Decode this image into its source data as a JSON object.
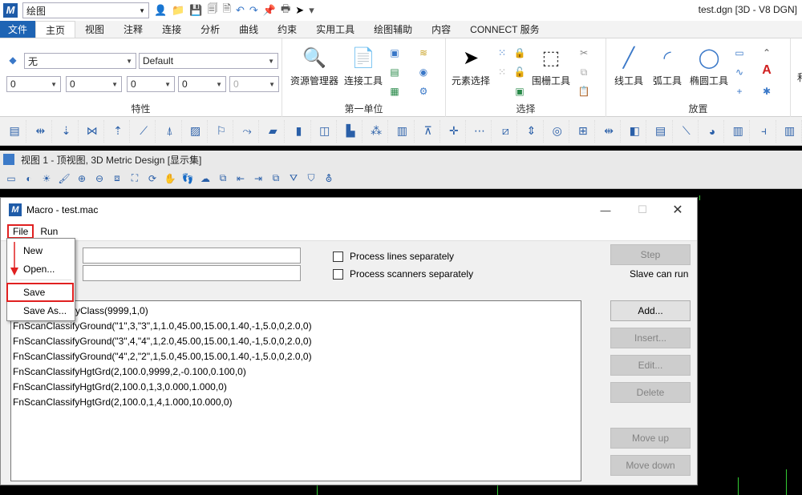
{
  "app": {
    "workspace": "绘图",
    "window_title": "test.dgn [3D - V8 DGN]"
  },
  "ribbon": {
    "tabs": [
      "文件",
      "主页",
      "视图",
      "注释",
      "连接",
      "分析",
      "曲线",
      "约束",
      "实用工具",
      "绘图辅助",
      "内容",
      "CONNECT 服务"
    ],
    "active_tab": "主页",
    "attributes": {
      "level": "无",
      "style": "Default",
      "color": "0",
      "line_style": "0",
      "weight": "0",
      "class": "0",
      "transparency": "0",
      "group_label": "特性"
    },
    "primary": {
      "explorer": "资源管理器",
      "attach": "连接工具",
      "group_label": "第一单位"
    },
    "selection": {
      "element_select": "元素选择",
      "fence": "围栅工具",
      "group_label": "选择"
    },
    "placement": {
      "line": "线工具",
      "arc": "弧工具",
      "ellipse": "椭圆工具",
      "text_icon": "A",
      "group_label": "放置",
      "partial": "和"
    }
  },
  "view": {
    "title": "视图 1 - 顶视图, 3D Metric Design [显示集]"
  },
  "dialog": {
    "title": "Macro - test.mac",
    "menu": {
      "file": "File",
      "run": "Run"
    },
    "dropdown": {
      "new": "New",
      "open": "Open...",
      "save": "Save",
      "save_as": "Save As..."
    },
    "options": {
      "process_lines": "Process lines separately",
      "process_scanners": "Process scanners separately",
      "slave": "Slave can run"
    },
    "buttons": {
      "step": "Step",
      "add": "Add...",
      "insert": "Insert...",
      "edit": "Edit...",
      "delete": "Delete",
      "move_up": "Move up",
      "move_down": "Move down"
    },
    "list": [
      "FnScanSetClass(9999,1,0)",
      "FnScanClassifyGround(\"1\",3,\"3\",1,1.0,45.00,15.00,1.40,-1,5.0,0,2.0,0)",
      "FnScanClassifyGround(\"3\",4,\"4\",1,2.0,45.00,15.00,1.40,-1,5.0,0,2.0,0)",
      "FnScanClassifyGround(\"4\",2,\"2\",1,5.0,45.00,15.00,1.40,-1,5.0,0,2.0,0)",
      "FnScanClassifyHgtGrd(2,100.0,9999,2,-0.100,0.100,0)",
      "FnScanClassifyHgtGrd(2,100.0,1,3,0.000,1.000,0)",
      "FnScanClassifyHgtGrd(2,100.0,1,4,1.000,10.000,0)"
    ],
    "list_first_visible": "yClass(9999,1,0)"
  },
  "colors": {
    "accent": "#1e64b4",
    "highlight": "#e02020"
  }
}
